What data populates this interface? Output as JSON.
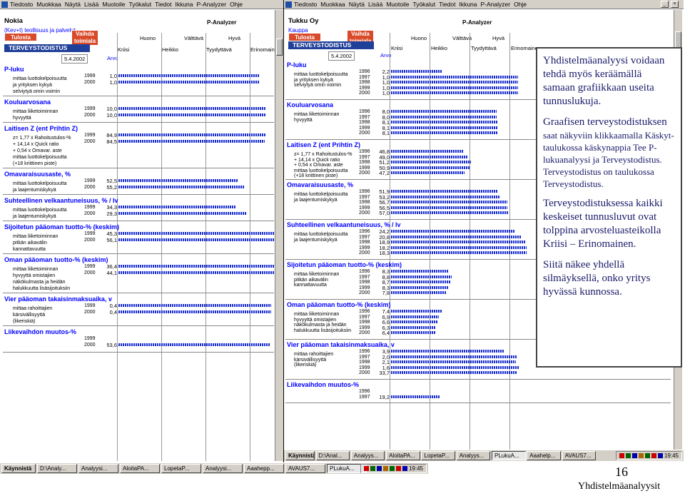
{
  "left_window": {
    "menu": [
      "Tiedosto",
      "Muokkaa",
      "Näytä",
      "Lisää",
      "Muotoile",
      "Työkalut",
      "Tiedot",
      "Ikkuna",
      "P-Analyzer",
      "Ohje"
    ],
    "company": "Nokia",
    "company_sub": "(Kev+t) teollisuus ja palvelut",
    "btn_print": "Tulosta",
    "btn_change": "Vaihda toimiala",
    "palyzer": "P-Analyzer",
    "grades": [
      "Huono",
      "Välttävä",
      "Hyvä"
    ],
    "grades2": [
      "Kriisi",
      "Heikko",
      "Tyydyttävä",
      "Erinomainen"
    ],
    "tv_bar": "TERVEYSTODISTUS",
    "date": "5.4.2002",
    "aiko": "Arvo",
    "sections": [
      {
        "title": "P-luku",
        "labels": [
          "mittaa luottokelpoisuutta",
          "ja yrityksen kykyä",
          "selviytyä omin voimin"
        ],
        "rows": [
          {
            "year": "1999",
            "value": "1,0"
          },
          {
            "year": "2000",
            "value": "1,0"
          }
        ]
      },
      {
        "title": "Kouluarvosana",
        "labels": [
          "mittaa liiketoiminnan",
          "hyvyyttä"
        ],
        "rows": [
          {
            "year": "1999",
            "value": "10,0"
          },
          {
            "year": "2000",
            "value": "10,0"
          }
        ]
      },
      {
        "title": "Laitisen Z  (ent Prihtin Z)",
        "labels": [
          "z=  1,77 x Rahoitustulos-%",
          "   + 14,14 x Quick ratio",
          "   + 0,54 x Omavar. aste",
          "mittaa luottokelpoisuutta",
          "(+18 kriittinen piste)"
        ],
        "rows": [
          {
            "year": "1999",
            "value": "84,9"
          },
          {
            "year": "2000",
            "value": "84,5"
          }
        ]
      },
      {
        "title": "Omavaraisuusaste, %",
        "labels": [
          "mittaa luottokelpoisuutta",
          "ja laajentumiskykyä"
        ],
        "rows": [
          {
            "year": "1999",
            "value": "52,5"
          },
          {
            "year": "2000",
            "value": "55,2"
          }
        ]
      },
      {
        "title": "Suhteellinen velkaantuneisuus, % / lv",
        "labels": [
          "mittaa luottokelpoisuutta",
          "ja laajentumiskykyä"
        ],
        "rows": [
          {
            "year": "1999",
            "value": "34,3"
          },
          {
            "year": "2000",
            "value": "29,3"
          }
        ]
      },
      {
        "title": "Sijoitetun pääoman tuotto-% (keskim)",
        "labels": [
          "mittaa liiketoiminnan",
          "pitkän aikavälin",
          "kannattavuutta"
        ],
        "rows": [
          {
            "year": "1999",
            "value": "45,3"
          },
          {
            "year": "2000",
            "value": "56,1"
          }
        ]
      },
      {
        "title": "Oman pääoman tuotto-% (keskim)",
        "labels": [
          "mittaa liiketoiminnan",
          "hyvyyttä omistajien",
          "näkökulmasta ja heidän",
          "halukkuutta lisäsijoituksiin"
        ],
        "rows": [
          {
            "year": "1999",
            "value": "36,4"
          },
          {
            "year": "2000",
            "value": "44,1"
          }
        ]
      },
      {
        "title": "Vier pääoman takaisinmaksuaika, v",
        "labels": [
          "mittaa rahoittajien",
          "kärsivällisyyttä",
          "(likeriskiä)"
        ],
        "rows": [
          {
            "year": "1999",
            "value": "0,4"
          },
          {
            "year": "2000",
            "value": "0,4"
          }
        ]
      },
      {
        "title": "Liikevaihdon muutos-%",
        "labels": [],
        "rows": [
          {
            "year": "1999",
            "value": ""
          },
          {
            "year": "2000",
            "value": "53,6"
          }
        ]
      }
    ],
    "taskbar": {
      "start": "Käynnistä",
      "buttons": [
        "D:\\Analy...",
        "Analyysi...",
        "AloitaPA...",
        "LopetaP...",
        "Analyysi...",
        "Aaahepp...",
        "AVAUS7...",
        "PLukuA..."
      ],
      "clock": "19:45"
    }
  },
  "right_window": {
    "menu": [
      "Tiedosto",
      "Muokkaa",
      "Näytä",
      "Lisää",
      "Muotoile",
      "Työkalut",
      "Tiedot",
      "Ikkuna",
      "P-Analyzer",
      "Ohje"
    ],
    "company": "Tukku Oy",
    "company_sub": "Kauppa",
    "btn_print": "Tulosta",
    "btn_change": "Vaihda toimiala",
    "palyzer": "P-Analyzer",
    "grades": [
      "Huono",
      "Välttävä",
      "Hyvä"
    ],
    "grades2": [
      "Kriisi",
      "Heikko",
      "Tyydyttävä",
      "Erinomainen"
    ],
    "tv_bar": "TERVEYSTODISTUS",
    "date": "5.4.2002",
    "aiko": "Arvo",
    "sections": [
      {
        "title": "P-luku",
        "labels": [
          "mittaa luottokelpoisuutta",
          "ja yrityksen kykyä",
          "selviytyä omin voimin"
        ],
        "rows": [
          {
            "year": "1996",
            "value": "2,2"
          },
          {
            "year": "1997",
            "value": "1,0"
          },
          {
            "year": "1998",
            "value": "1,0"
          },
          {
            "year": "1999",
            "value": "1,0"
          },
          {
            "year": "2000",
            "value": "1,0"
          }
        ]
      },
      {
        "title": "Kouluarvosana",
        "labels": [
          "mittaa liiketoiminnan",
          "hyvyyttä"
        ],
        "rows": [
          {
            "year": "1996",
            "value": "8,0"
          },
          {
            "year": "1997",
            "value": "8,0"
          },
          {
            "year": "1998",
            "value": "8,1"
          },
          {
            "year": "1999",
            "value": "8,1"
          },
          {
            "year": "2000",
            "value": "8,1"
          }
        ]
      },
      {
        "title": "Laitisen Z  (ent Prihtin Z)",
        "labels": [
          "z=  1,77 x Rahoitustulos-%",
          "   + 14,14 x Quick ratio",
          "   + 0,54 x Omavar. aste",
          "mittaa luottokelpoisuutta",
          "(+18 kriittinen piste)"
        ],
        "rows": [
          {
            "year": "1996",
            "value": "46,8"
          },
          {
            "year": "1997",
            "value": "49,0"
          },
          {
            "year": "1998",
            "value": "51,2"
          },
          {
            "year": "1999",
            "value": "50,9"
          },
          {
            "year": "2000",
            "value": "47,2"
          }
        ]
      },
      {
        "title": "Omavaraisuusaste, %",
        "labels": [
          "mittaa luottokelpoisuutta",
          "ja laajentumiskykyä"
        ],
        "rows": [
          {
            "year": "1996",
            "value": "51,9"
          },
          {
            "year": "1997",
            "value": "53,2"
          },
          {
            "year": "1998",
            "value": "56,7"
          },
          {
            "year": "1999",
            "value": "56,5"
          },
          {
            "year": "2000",
            "value": "57,0"
          }
        ]
      },
      {
        "title": "Suhteellinen velkaantuneisuus, % / lv",
        "labels": [
          "mittaa luottokelpoisuutta",
          "ja laajentumiskykyä"
        ],
        "rows": [
          {
            "year": "1996",
            "value": "24,2"
          },
          {
            "year": "1997",
            "value": "20,8"
          },
          {
            "year": "1998",
            "value": "18,9"
          },
          {
            "year": "1999",
            "value": "18,2"
          },
          {
            "year": "2000",
            "value": "18,3"
          }
        ]
      },
      {
        "title": "Sijoitetun pääoman tuotto-% (keskim)",
        "labels": [
          "mittaa liiketoiminnan",
          "pitkän aikavälin",
          "kannattavuutta"
        ],
        "rows": [
          {
            "year": "1996",
            "value": "8,3"
          },
          {
            "year": "1997",
            "value": "8,8"
          },
          {
            "year": "1998",
            "value": "8,7"
          },
          {
            "year": "1999",
            "value": "8,3"
          },
          {
            "year": "2000",
            "value": "7,8"
          }
        ]
      },
      {
        "title": "Oman pääoman tuotto-% (keskim)",
        "labels": [
          "mittaa liiketoiminnan",
          "hyvyyttä omistajien",
          "näkökulmasta ja heidän",
          "halukkuutta lisäsijoituksiin"
        ],
        "rows": [
          {
            "year": "1996",
            "value": "7,4"
          },
          {
            "year": "1997",
            "value": "6,9"
          },
          {
            "year": "1998",
            "value": "6,6"
          },
          {
            "year": "1999",
            "value": "6,3"
          },
          {
            "year": "2000",
            "value": "6,4"
          }
        ]
      },
      {
        "title": "Vier pääoman takaisinmaksuaika, v",
        "labels": [
          "mittaa rahoittajien",
          "kärsivällisyyttä",
          "(likeriskiä)"
        ],
        "rows": [
          {
            "year": "1996",
            "value": "3,9"
          },
          {
            "year": "1997",
            "value": "2,0"
          },
          {
            "year": "1998",
            "value": "2,1"
          },
          {
            "year": "1999",
            "value": "1,6"
          },
          {
            "year": "2000",
            "value": "33,7"
          }
        ]
      },
      {
        "title": "Liikevaihdon muutos-%",
        "labels": [],
        "rows": [
          {
            "year": "1996",
            "value": ""
          },
          {
            "year": "1997",
            "value": "19,2"
          }
        ]
      }
    ],
    "taskbar": {
      "start": "Käynnistä",
      "buttons": [
        "D:\\Anal...",
        "Analyys...",
        "AloitaPA...",
        "LopetaP...",
        "Analyys...",
        "PLukuA...",
        "Aaahelp...",
        "AVAUS7..."
      ],
      "clock": "19:45"
    }
  },
  "text_box": {
    "p1": "Yhdistelmäanalyysi voidaan tehdä myös keräämällä samaan grafiikkaan useita tunnuslukuja.",
    "p2_title": "Graafisen terveystodistuksen",
    "p2_body": "saat näkyviin klikkaamalla Käskyt-taulukossa käskynappia Tee P-lukuanalyysi ja Terveystodistus. Terveystodistus on taulukossa Terveystodistus.",
    "p3": "Terveystodistuksessa kaikki keskeiset tunnusluvut ovat tolppina arvosteluasteikolla Kriisi – Erinomainen.",
    "p4": "Siitä näkee yhdellä silmäyksellä, onko yritys hyvässä kunnossa."
  },
  "page_number": "16",
  "footer": "Yhdistelmäanalyysit"
}
